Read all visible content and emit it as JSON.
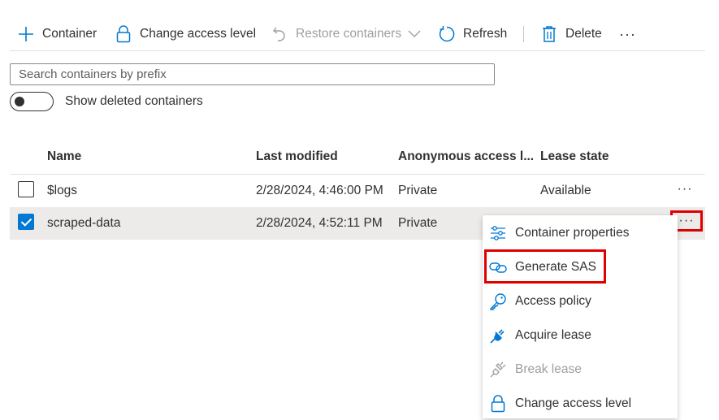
{
  "toolbar": {
    "container_label": "Container",
    "change_access_label": "Change access level",
    "restore_label": "Restore containers",
    "refresh_label": "Refresh",
    "delete_label": "Delete",
    "more_label": "···"
  },
  "search": {
    "placeholder": "Search containers by prefix",
    "value": ""
  },
  "toggle": {
    "label": "Show deleted containers",
    "on": false
  },
  "table": {
    "columns": [
      "Name",
      "Last modified",
      "Anonymous access l...",
      "Lease state"
    ],
    "rows": [
      {
        "checked": false,
        "name": "$logs",
        "last_modified": "2/28/2024, 4:46:00 PM",
        "access": "Private",
        "lease": "Available",
        "more": "···"
      },
      {
        "checked": true,
        "name": "scraped-data",
        "last_modified": "2/28/2024, 4:52:11 PM",
        "access": "Private",
        "lease": "",
        "more": "···"
      }
    ]
  },
  "context_menu": {
    "items": [
      {
        "label": "Container properties",
        "icon": "sliders-icon",
        "disabled": false
      },
      {
        "label": "Generate SAS",
        "icon": "link-icon",
        "disabled": false
      },
      {
        "label": "Access policy",
        "icon": "key-icon",
        "disabled": false
      },
      {
        "label": "Acquire lease",
        "icon": "plug-icon",
        "disabled": false
      },
      {
        "label": "Break lease",
        "icon": "broken-plug-icon",
        "disabled": true
      },
      {
        "label": "Change access level",
        "icon": "lock-icon",
        "disabled": false
      }
    ]
  },
  "colors": {
    "accent": "#0078d4",
    "highlight": "#e00000",
    "disabled": "#a19f9d",
    "selected_row": "#edebe9"
  }
}
